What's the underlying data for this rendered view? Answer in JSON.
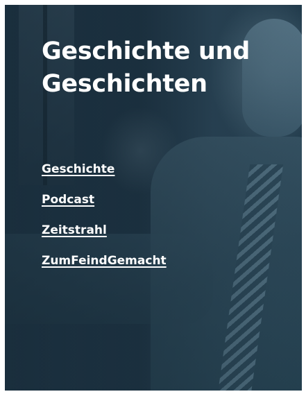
{
  "hero": {
    "title_line1": "Geschichte und",
    "title_line2": "Geschichten",
    "background_image": "duotone-photo-elderly-man-in-suit",
    "overlay_color": "#1f3442"
  },
  "nav": {
    "items": [
      {
        "label": "Geschichte"
      },
      {
        "label": "Podcast"
      },
      {
        "label": "Zeitstrahl"
      },
      {
        "label": "ZumFeindGemacht"
      }
    ]
  }
}
